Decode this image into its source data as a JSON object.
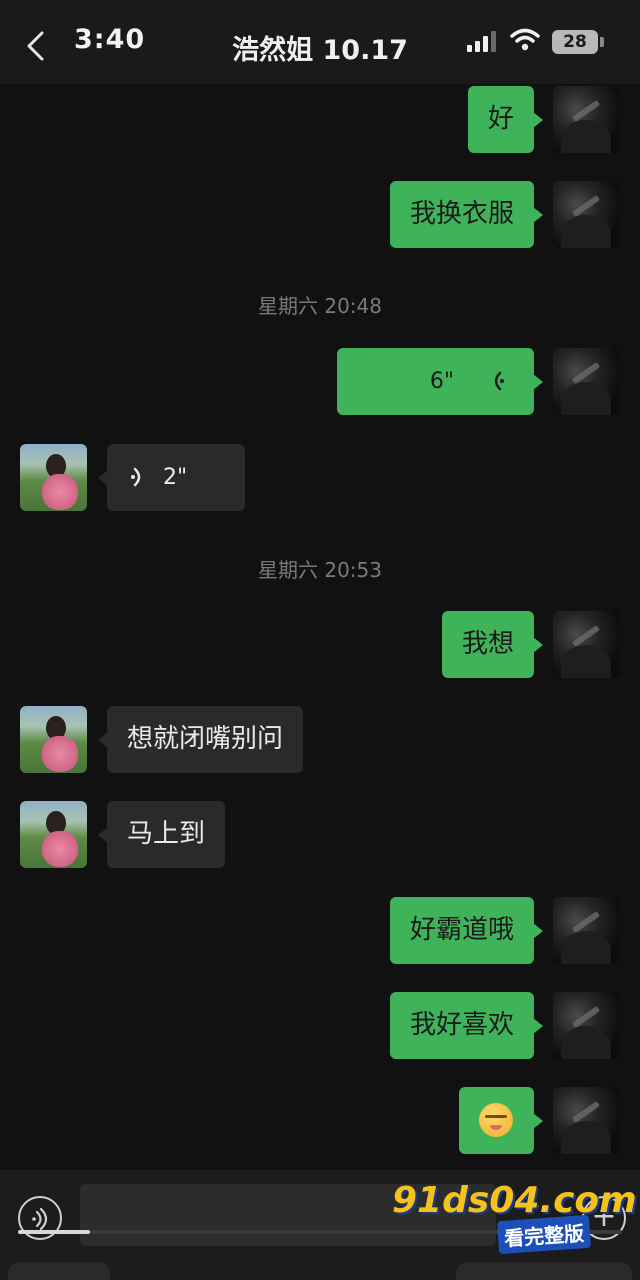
{
  "status_bar": {
    "time": "3:40",
    "battery": "28",
    "icons": [
      "back-icon",
      "signal-icon",
      "wifi-icon",
      "battery-icon"
    ]
  },
  "header": {
    "title": "浩然姐 10.17"
  },
  "messages": [
    {
      "side": "out",
      "type": "text",
      "text": "好"
    },
    {
      "side": "out",
      "type": "text",
      "text": "我换衣服"
    },
    {
      "type": "timestamp",
      "text": "星期六 20:48"
    },
    {
      "side": "out",
      "type": "voice",
      "duration": "6\""
    },
    {
      "side": "in",
      "type": "voice",
      "duration": "2\""
    },
    {
      "type": "timestamp",
      "text": "星期六 20:53"
    },
    {
      "side": "out",
      "type": "text",
      "text": "我想"
    },
    {
      "side": "in",
      "type": "text",
      "text": "想就闭嘴别问"
    },
    {
      "side": "in",
      "type": "text",
      "text": "马上到"
    },
    {
      "side": "out",
      "type": "text",
      "text": "好霸道哦"
    },
    {
      "side": "out",
      "type": "text",
      "text": "我好喜欢"
    },
    {
      "side": "out",
      "type": "emoji",
      "icon": "grinning-face-emoji-icon"
    }
  ],
  "input_bar": {
    "placeholder": "",
    "progress": 0.12
  },
  "watermark": {
    "main": "91ds04.com",
    "sub": "看完整版"
  },
  "colors": {
    "outgoing_bubble": "#3fb35a",
    "incoming_bubble": "#2a2a2a",
    "background": "#111111"
  }
}
